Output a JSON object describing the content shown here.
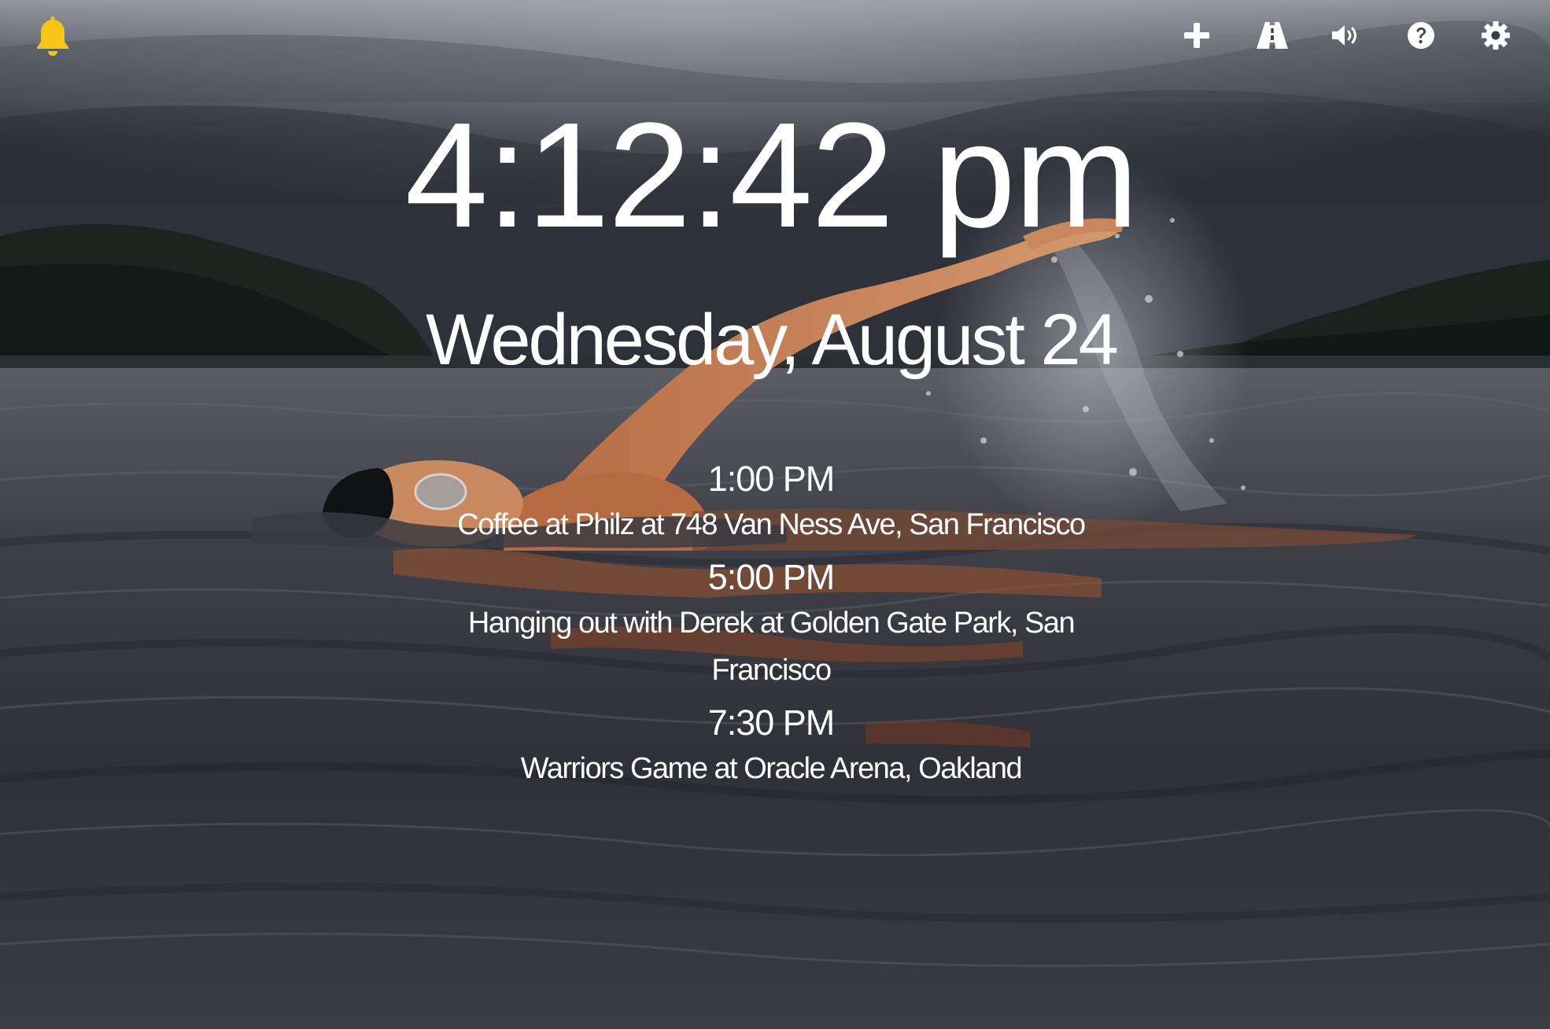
{
  "clock": {
    "time": "4:12:42 pm",
    "date": "Wednesday, August 24"
  },
  "toolbar": {
    "alarm_icon": "bell-icon",
    "alarm_color": "#f5c518",
    "add_icon": "plus-icon",
    "road_icon": "road-icon",
    "volume_icon": "volume-icon",
    "help_icon": "question-circle-icon",
    "settings_icon": "gear-icon"
  },
  "events": [
    {
      "time": "1:00 PM",
      "title": "Coffee at Philz at 748 Van Ness Ave, San Francisco"
    },
    {
      "time": "5:00 PM",
      "title": "Hanging out with Derek at Golden Gate Park, San Francisco"
    },
    {
      "time": "7:30 PM",
      "title": "Warriors Game at Oracle Arena, Oakland"
    }
  ]
}
